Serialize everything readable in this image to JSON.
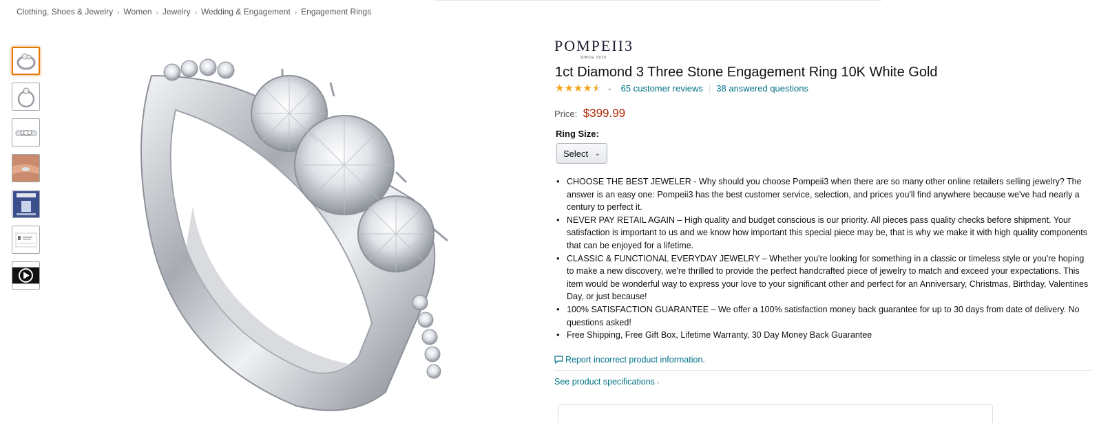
{
  "breadcrumb": [
    "Clothing, Shoes & Jewelry",
    "Women",
    "Jewelry",
    "Wedding & Engagement",
    "Engagement Rings"
  ],
  "breadcrumb_separator": "›",
  "thumbnails": [
    "ring-angle",
    "ring-side",
    "ring-top",
    "ring-on-hand",
    "lifetime-warranty-card",
    "warranty-document",
    "play-video-icon"
  ],
  "brand": {
    "name": "POMPEII3",
    "since": "SINCE 1919"
  },
  "product": {
    "title": "1ct Diamond 3 Three Stone Engagement Ring 10K White Gold",
    "rating": 4.5,
    "reviews_text": "65 customer reviews",
    "questions_text": "38 answered questions",
    "price_label": "Price:",
    "price": "$399.99",
    "ring_size_label": "Ring Size:",
    "ring_size_selected": "Select"
  },
  "bullets": [
    "CHOOSE THE BEST JEWELER - Why should you choose Pompeii3 when there are so many other online retailers selling jewelry? The answer is an easy one: Pompeii3 has the best customer service, selection, and prices you'll find anywhere because we've had nearly a century to perfect it.",
    "NEVER PAY RETAIL AGAIN – High quality and budget conscious is our priority. All pieces pass quality checks before shipment. Your satisfaction is important to us and we know how important this special piece may be, that is why we make it with high quality components that can be enjoyed for a lifetime.",
    "CLASSIC & FUNCTIONAL EVERYDAY JEWELRY – Whether you're looking for something in a classic or timeless style or you're hoping to make a new discovery, we're thrilled to provide the perfect handcrafted piece of jewelry to match and exceed your expectations. This item would be wonderful way to express your love to your significant other and perfect for an Anniversary, Christmas, Birthday, Valentines Day, or just because!",
    "100% SATISFACTION GUARANTEE – We offer a 100% satisfaction money back guarantee for up to 30 days from date of delivery. No questions asked!",
    "Free Shipping, Free Gift Box, Lifetime Warranty, 30 Day Money Back Guarantee"
  ],
  "links": {
    "report": "Report incorrect product information.",
    "specs": "See product specifications"
  },
  "colors": {
    "accent_link": "#007185",
    "price": "#b12704",
    "star": "#f4a41d",
    "selected_thumb": "#e77600"
  }
}
